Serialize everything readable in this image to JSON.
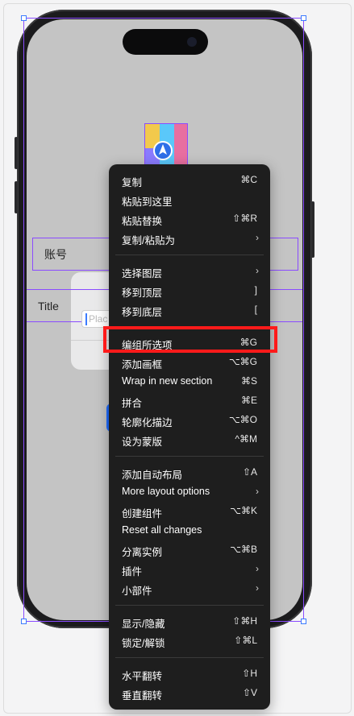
{
  "screen": {
    "account_label": "账号",
    "title_label": "Title",
    "input_placeholder": "Plac"
  },
  "context_menu": {
    "groups": [
      [
        {
          "label": "复制",
          "shortcut": "⌘C"
        },
        {
          "label": "粘贴到这里",
          "shortcut": ""
        },
        {
          "label": "粘贴替换",
          "shortcut": "⇧⌘R"
        },
        {
          "label": "复制/粘贴为",
          "submenu": true
        }
      ],
      [
        {
          "label": "选择图层",
          "submenu": true
        },
        {
          "label": "移到顶层",
          "shortcut": "]"
        },
        {
          "label": "移到底层",
          "shortcut": "["
        }
      ],
      [
        {
          "label": "编组所选项",
          "shortcut": "⌘G",
          "highlighted": true
        },
        {
          "label": "添加画框",
          "shortcut": "⌥⌘G"
        },
        {
          "label": "Wrap in new section",
          "shortcut": "⌘S"
        },
        {
          "label": "拼合",
          "shortcut": "⌘E"
        },
        {
          "label": "轮廓化描边",
          "shortcut": "⌥⌘O"
        },
        {
          "label": "设为蒙版",
          "shortcut": "^⌘M"
        }
      ],
      [
        {
          "label": "添加自动布局",
          "shortcut": "⇧A"
        },
        {
          "label": "More layout options",
          "submenu": true
        },
        {
          "label": "创建组件",
          "shortcut": "⌥⌘K"
        },
        {
          "label": "Reset all changes",
          "shortcut": ""
        },
        {
          "label": "分离实例",
          "shortcut": "⌥⌘B"
        },
        {
          "label": "插件",
          "submenu": true
        },
        {
          "label": "小部件",
          "submenu": true
        }
      ],
      [
        {
          "label": "显示/隐藏",
          "shortcut": "⇧⌘H"
        },
        {
          "label": "锁定/解锁",
          "shortcut": "⇧⌘L"
        }
      ],
      [
        {
          "label": "水平翻转",
          "shortcut": "⇧H"
        },
        {
          "label": "垂直翻转",
          "shortcut": "⇧V"
        }
      ]
    ],
    "submenu_glyph": "›"
  },
  "colors": {
    "menu_bg": "#1e1e1e",
    "selection": "#8a4bff",
    "highlight": "#ff1a1a",
    "handle": "#3b7bff"
  },
  "icons": {
    "app_icon": "maps-app-icon"
  }
}
